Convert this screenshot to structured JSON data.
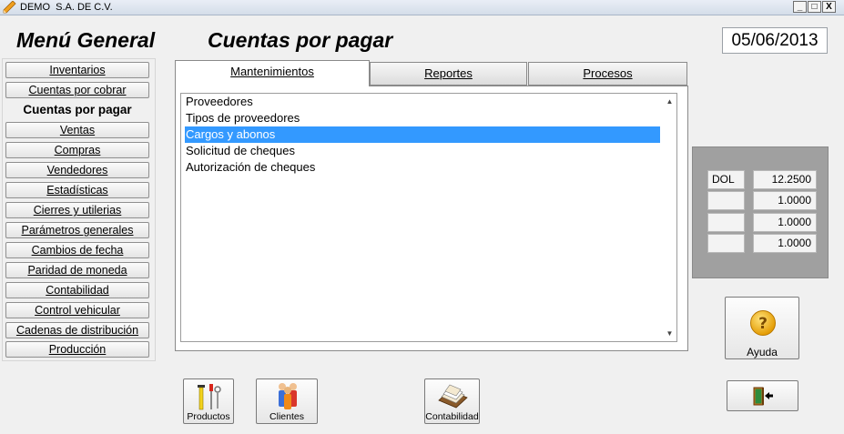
{
  "window": {
    "title": "DEMO  S.A. DE C.V.",
    "minimize": "_",
    "maximize": "□",
    "close": "X"
  },
  "header": {
    "menu_title": "Menú General",
    "section_title": "Cuentas por pagar",
    "date": "05/06/2013"
  },
  "sidebar": {
    "items": [
      {
        "label": "Inventarios"
      },
      {
        "label": "Cuentas por cobrar"
      },
      {
        "label": "Cuentas por pagar"
      },
      {
        "label": "Ventas"
      },
      {
        "label": "Compras"
      },
      {
        "label": "Vendedores"
      },
      {
        "label": "Estadísticas"
      },
      {
        "label": "Cierres y utilerias"
      },
      {
        "label": "Parámetros generales"
      },
      {
        "label": "Cambios de fecha"
      },
      {
        "label": "Paridad de moneda"
      },
      {
        "label": "Contabilidad"
      },
      {
        "label": "Control vehicular"
      },
      {
        "label": "Cadenas de distribución"
      },
      {
        "label": "Producción"
      }
    ]
  },
  "tabs": [
    {
      "label": "Mantenimientos"
    },
    {
      "label": "Reportes"
    },
    {
      "label": "Procesos"
    }
  ],
  "list": {
    "items": [
      {
        "label": "Proveedores"
      },
      {
        "label": "Tipos de proveedores"
      },
      {
        "label": "Cargos y abonos"
      },
      {
        "label": "Solicitud de cheques"
      },
      {
        "label": "Autorización de cheques"
      }
    ],
    "selected_index": 2
  },
  "currency": {
    "rows": [
      {
        "code": "DOL",
        "value": "12.2500"
      },
      {
        "code": "",
        "value": "1.0000"
      },
      {
        "code": "",
        "value": "1.0000"
      },
      {
        "code": "",
        "value": "1.0000"
      }
    ]
  },
  "buttons": {
    "help": "Ayuda",
    "productos": "Productos",
    "clientes": "Clientes",
    "contabilidad": "Contabilidad"
  },
  "icons": {
    "help": "question-icon",
    "exit": "exit-door-icon",
    "productos": "tools-icon",
    "clientes": "people-icon",
    "contabilidad": "card-file-icon"
  },
  "colors": {
    "selection": "#3399ff",
    "help_icon": "#f5b400"
  }
}
